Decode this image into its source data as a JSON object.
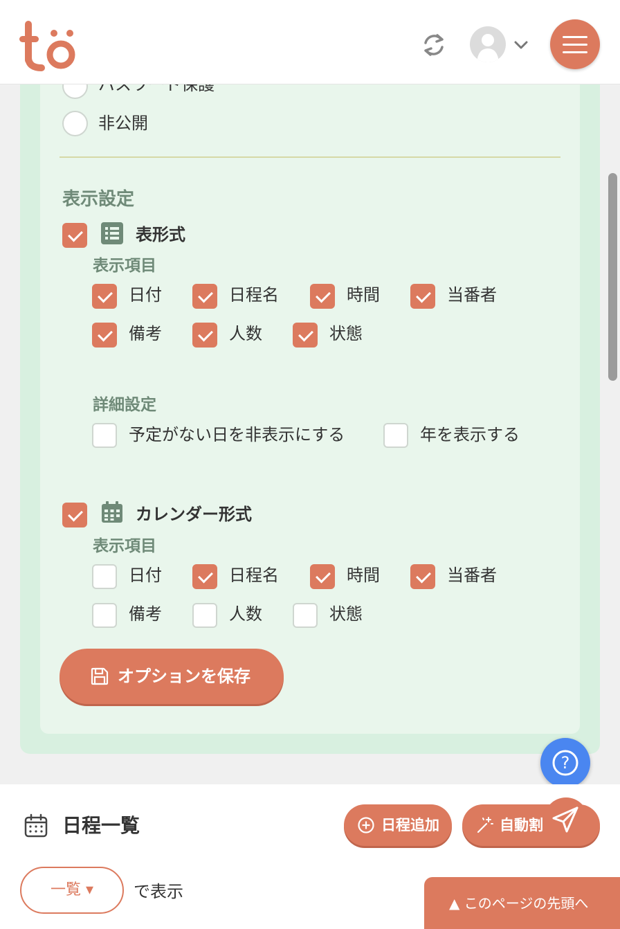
{
  "header": {
    "logo_text": "tö",
    "sync_icon": "sync-icon",
    "user_icon": "user-avatar-icon",
    "menu_icon": "hamburger-menu-icon"
  },
  "visibility": {
    "options": [
      {
        "label": "パスワード保護",
        "selected": false
      },
      {
        "label": "非公開",
        "selected": false
      }
    ]
  },
  "display_settings": {
    "title": "表示設定",
    "table_format": {
      "label": "表形式",
      "checked": true,
      "icon": "table-list-icon",
      "items_title": "表示項目",
      "items": [
        {
          "label": "日付",
          "checked": true
        },
        {
          "label": "日程名",
          "checked": true
        },
        {
          "label": "時間",
          "checked": true
        },
        {
          "label": "当番者",
          "checked": true
        },
        {
          "label": "備考",
          "checked": true
        },
        {
          "label": "人数",
          "checked": true
        },
        {
          "label": "状態",
          "checked": true
        }
      ],
      "detail_title": "詳細設定",
      "details": [
        {
          "label": "予定がない日を非表示にする",
          "checked": false
        },
        {
          "label": "年を表示する",
          "checked": false
        }
      ]
    },
    "calendar_format": {
      "label": "カレンダー形式",
      "checked": true,
      "icon": "calendar-icon",
      "items_title": "表示項目",
      "items": [
        {
          "label": "日付",
          "checked": false
        },
        {
          "label": "日程名",
          "checked": true
        },
        {
          "label": "時間",
          "checked": true
        },
        {
          "label": "当番者",
          "checked": true
        },
        {
          "label": "備考",
          "checked": false
        },
        {
          "label": "人数",
          "checked": false
        },
        {
          "label": "状態",
          "checked": false
        }
      ]
    },
    "save_button": "オプションを保存"
  },
  "help_button": "?",
  "schedule": {
    "title": "日程一覧",
    "add_button": "日程追加",
    "auto_button": "自動割",
    "view_select": "一覧 ▾",
    "view_suffix": "で表示"
  },
  "to_top": "▲ このページの先頭へ",
  "colors": {
    "accent": "#dc7a5e",
    "panel_outer": "#d8f0e0",
    "panel_inner": "#e9f6ec",
    "label_green": "#6f8a78",
    "help_blue": "#4a86f0"
  }
}
